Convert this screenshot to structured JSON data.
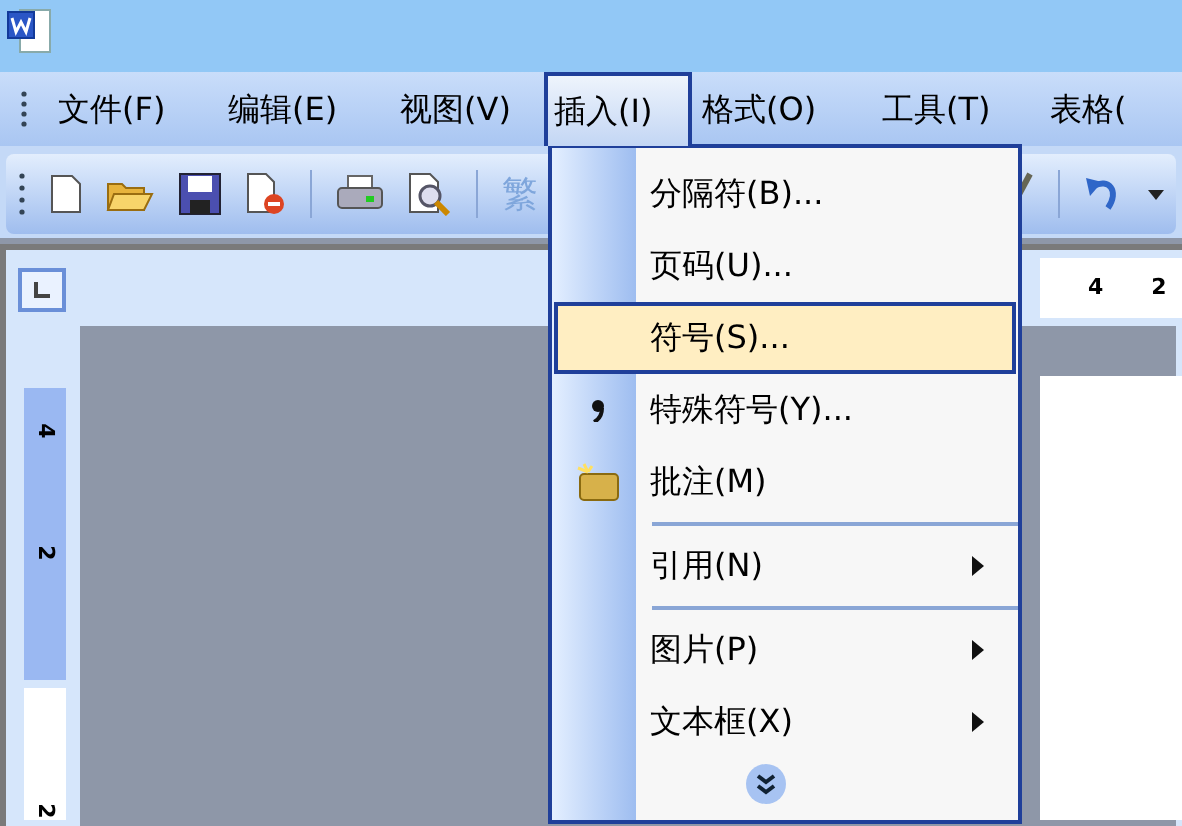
{
  "menu_bar": [
    {
      "label": "文件(F)",
      "selected": false
    },
    {
      "label": "编辑(E)",
      "selected": false
    },
    {
      "label": "视图(V)",
      "selected": false
    },
    {
      "label": "插入(I)",
      "selected": true
    },
    {
      "label": "格式(O)",
      "selected": false
    },
    {
      "label": "工具(T)",
      "selected": false
    },
    {
      "label": "表格(",
      "selected": false
    }
  ],
  "toolbar": {
    "partial_text": "繁"
  },
  "ruler": {
    "horizontal": [
      "4",
      "2"
    ],
    "vertical": [
      "4",
      "2",
      "2"
    ]
  },
  "insert_menu": {
    "items": [
      {
        "kind": "item",
        "label": "分隔符(B)...",
        "selected": false,
        "submenu": false
      },
      {
        "kind": "item",
        "label": "页码(U)...",
        "selected": false,
        "submenu": false
      },
      {
        "kind": "item",
        "label": "符号(S)...",
        "selected": true,
        "submenu": false
      },
      {
        "label": "特殊符号(Y)...",
        "selected": false,
        "submenu": false,
        "kind": "symbol"
      },
      {
        "label": "批注(M)",
        "selected": false,
        "submenu": false,
        "kind": "comment"
      },
      {
        "kind": "separator"
      },
      {
        "kind": "item",
        "label": "引用(N)",
        "selected": false,
        "submenu": true
      },
      {
        "kind": "separator"
      },
      {
        "kind": "item",
        "label": "图片(P)",
        "selected": false,
        "submenu": true
      },
      {
        "kind": "item",
        "label": "文本框(X)",
        "selected": false,
        "submenu": true
      },
      {
        "kind": "expand"
      }
    ]
  }
}
